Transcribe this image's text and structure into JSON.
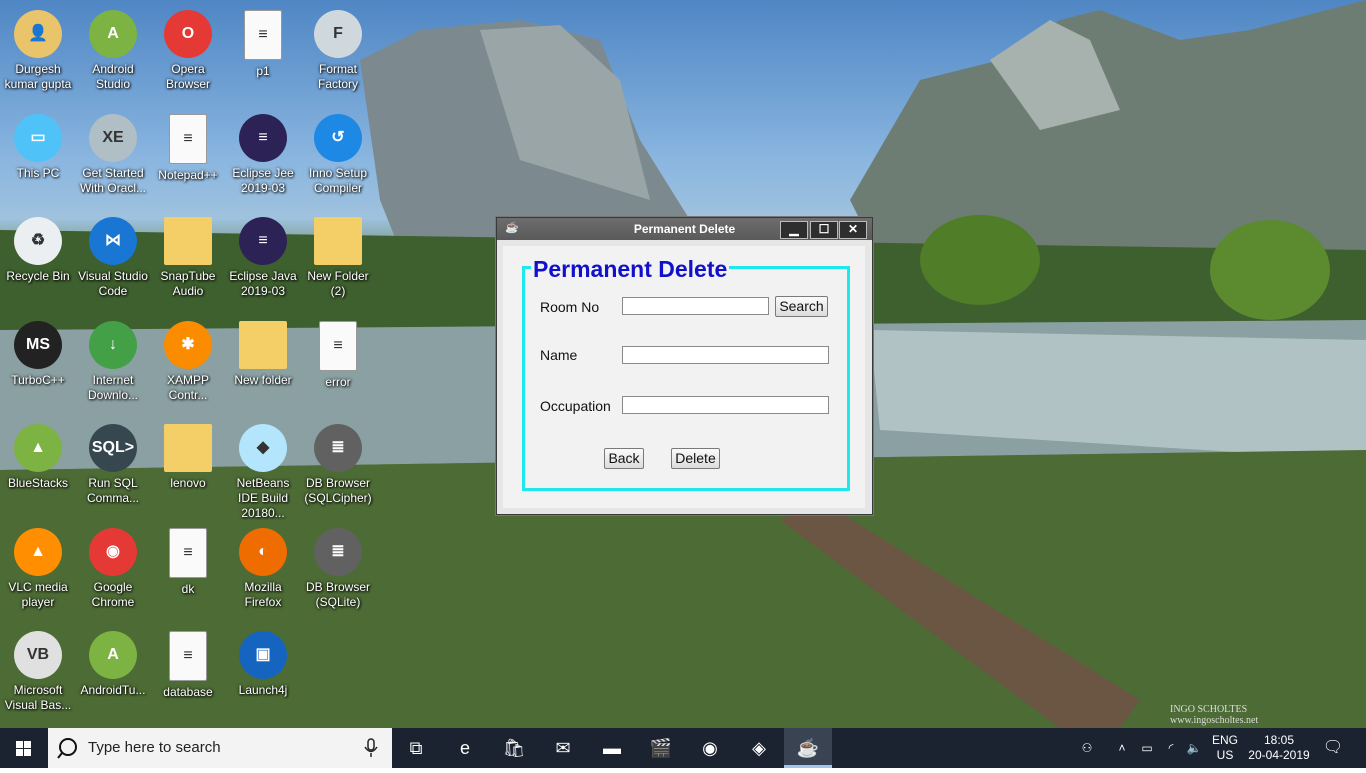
{
  "desktop": {
    "icons": [
      {
        "label": "Durgesh kumar gupta",
        "icon": "user-folder-icon"
      },
      {
        "label": "Android Studio",
        "icon": "android-studio-icon"
      },
      {
        "label": "Opera Browser",
        "icon": "opera-icon"
      },
      {
        "label": "p1",
        "icon": "file-icon"
      },
      {
        "label": "Format Factory",
        "icon": "format-factory-icon"
      },
      {
        "label": "This PC",
        "icon": "computer-icon"
      },
      {
        "label": "Get Started With Oracl...",
        "icon": "oracle-db-icon"
      },
      {
        "label": "Notepad++",
        "icon": "file-icon"
      },
      {
        "label": "Eclipse Jee 2019-03",
        "icon": "eclipse-icon"
      },
      {
        "label": "Inno Setup Compiler",
        "icon": "inno-setup-icon"
      },
      {
        "label": "Recycle Bin",
        "icon": "recycle-bin-icon"
      },
      {
        "label": "Visual Studio Code",
        "icon": "vscode-icon"
      },
      {
        "label": "SnapTube Audio",
        "icon": "folder-icon"
      },
      {
        "label": "Eclipse Java 2019-03",
        "icon": "eclipse-icon"
      },
      {
        "label": "New Folder (2)",
        "icon": "folder-icon"
      },
      {
        "label": "TurboC++",
        "icon": "turbo-c-icon"
      },
      {
        "label": "Internet Downlo...",
        "icon": "idm-icon"
      },
      {
        "label": "XAMPP Contr...",
        "icon": "xampp-icon"
      },
      {
        "label": "New folder",
        "icon": "folder-icon"
      },
      {
        "label": "error",
        "icon": "file-icon"
      },
      {
        "label": "BlueStacks",
        "icon": "bluestacks-icon"
      },
      {
        "label": "Run SQL Comma...",
        "icon": "sql-terminal-icon"
      },
      {
        "label": "lenovo",
        "icon": "folder-icon"
      },
      {
        "label": "NetBeans IDE Build 20180...",
        "icon": "netbeans-icon"
      },
      {
        "label": "DB Browser (SQLCipher)",
        "icon": "database-icon"
      },
      {
        "label": "VLC media player",
        "icon": "vlc-icon"
      },
      {
        "label": "Google Chrome",
        "icon": "chrome-icon"
      },
      {
        "label": "dk",
        "icon": "file-icon"
      },
      {
        "label": "Mozilla Firefox",
        "icon": "firefox-icon"
      },
      {
        "label": "DB Browser (SQLite)",
        "icon": "database-icon"
      },
      {
        "label": "Microsoft Visual Bas...",
        "icon": "visual-basic-icon"
      },
      {
        "label": "AndroidTu...",
        "icon": "android-studio-icon"
      },
      {
        "label": "database",
        "icon": "file-icon"
      },
      {
        "label": "Launch4j",
        "icon": "launch4j-icon"
      }
    ],
    "watermark": "INGO SCHOLTES\nwww.ingoscholtes.net"
  },
  "window": {
    "title": "Permanent Delete",
    "minimize": "▁",
    "maximize": "☐",
    "close": "✕",
    "heading": "Permanent Delete",
    "room_label": "Room No",
    "room_value": "",
    "search_button": "Search",
    "name_label": "Name",
    "name_value": "",
    "occupation_label": "Occupation",
    "occupation_value": "",
    "back_button": "Back",
    "delete_button": "Delete",
    "accent_color": "#1ee8ee",
    "heading_color": "#1111cc"
  },
  "taskbar": {
    "search_placeholder": "Type here to search",
    "apps": [
      "task-view-icon",
      "edge-icon",
      "store-icon",
      "mail-icon",
      "file-explorer-icon",
      "movies-icon",
      "chrome-icon",
      "virtualbox-icon",
      "java-icon"
    ],
    "lang_top": "ENG",
    "lang_bottom": "US",
    "time": "18:05",
    "date": "20-04-2019"
  }
}
